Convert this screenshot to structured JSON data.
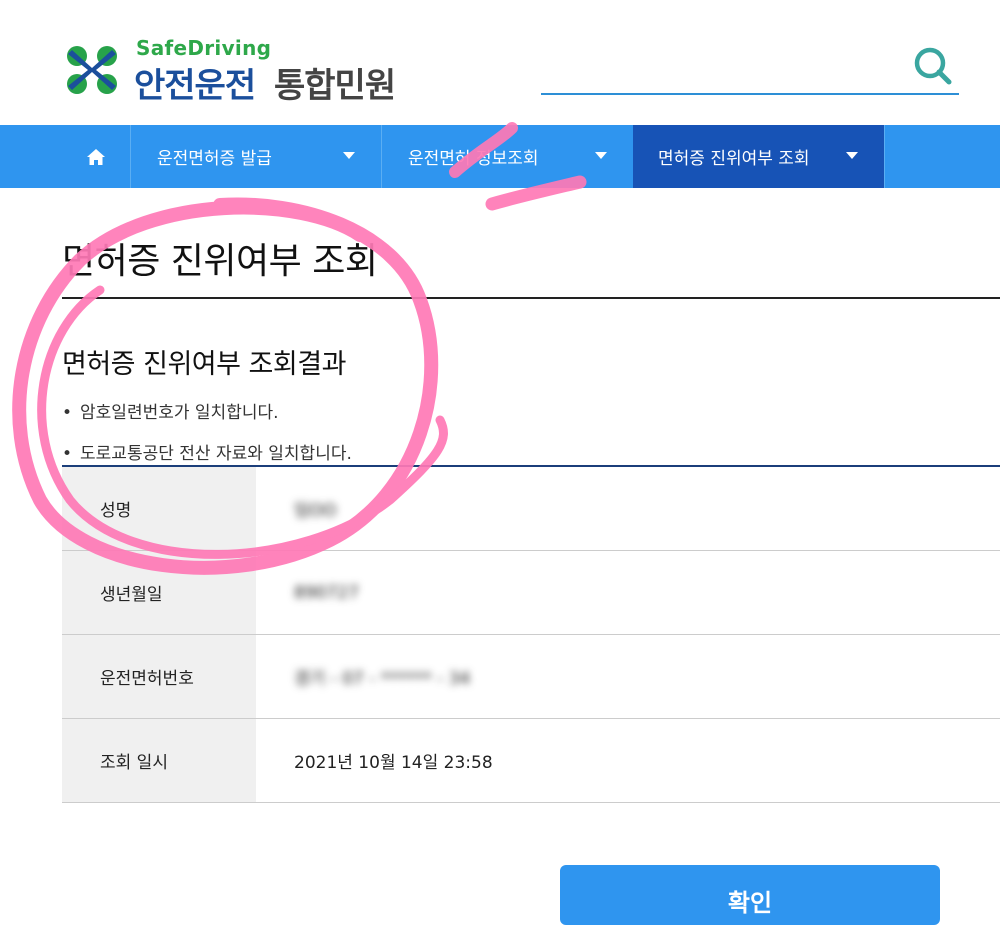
{
  "header": {
    "logo_en": "SafeDriving",
    "logo_ko_main": "안전운전",
    "logo_ko_sub": "통합민원",
    "search": {
      "placeholder": "",
      "value": "",
      "icon": "search-icon"
    }
  },
  "nav": {
    "home_icon": "home-icon",
    "items": [
      {
        "label": "운전면허증 발급",
        "active": false
      },
      {
        "label": "운전면허 정보조회",
        "active": false
      },
      {
        "label": "면허증 진위여부 조회",
        "active": true
      }
    ]
  },
  "page": {
    "title": "면허증 진위여부 조회",
    "section_title": "면허증 진위여부 조회결과",
    "bullets": [
      "암호일련번호가 일치합니다.",
      "도로교통공단 전산 자료와 일치합니다."
    ]
  },
  "result_table": {
    "rows": [
      {
        "label": "성명",
        "value": "임OO",
        "blurred": true
      },
      {
        "label": "생년월일",
        "value": "890727",
        "blurred": true
      },
      {
        "label": "운전면허번호",
        "value": "경기 - 07 - ****** - 34",
        "blurred": true
      },
      {
        "label": "조회 일시",
        "value": "2021년 10월 14일 23:58",
        "blurred": false
      }
    ]
  },
  "confirm_button": {
    "label": "확인"
  },
  "colors": {
    "nav_bg": "#2f95ef",
    "nav_active": "#1753b6",
    "brand_blue": "#1b4f9c",
    "brand_green": "#2ea84a",
    "annotation_pink": "#ff69b4"
  }
}
